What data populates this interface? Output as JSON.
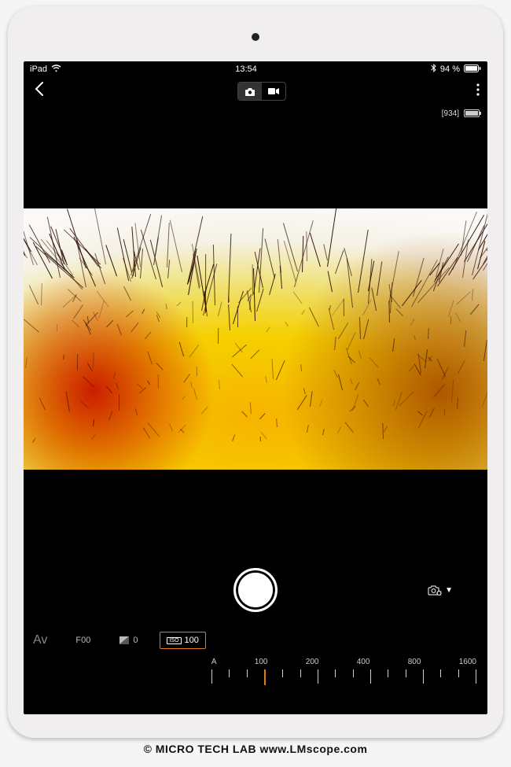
{
  "statusbar": {
    "carrier": "iPad",
    "time": "13:54",
    "battery_percent": "94 %",
    "bluetooth": true
  },
  "appbar": {
    "back": true,
    "mode_photo_active": true
  },
  "camera_status": {
    "shots_remaining": "[934]"
  },
  "controls": {
    "mode_label": "Av",
    "aperture_label": "F00",
    "ev_value": "0",
    "iso_prefix": "ISO",
    "iso_value": "100"
  },
  "iso_scale": {
    "labels": [
      "A",
      "100",
      "200",
      "400",
      "800",
      "1600"
    ],
    "selected_index": 1
  },
  "watermark": {
    "text": "©  MICRO TECH LAB     www.LMscope.com"
  }
}
